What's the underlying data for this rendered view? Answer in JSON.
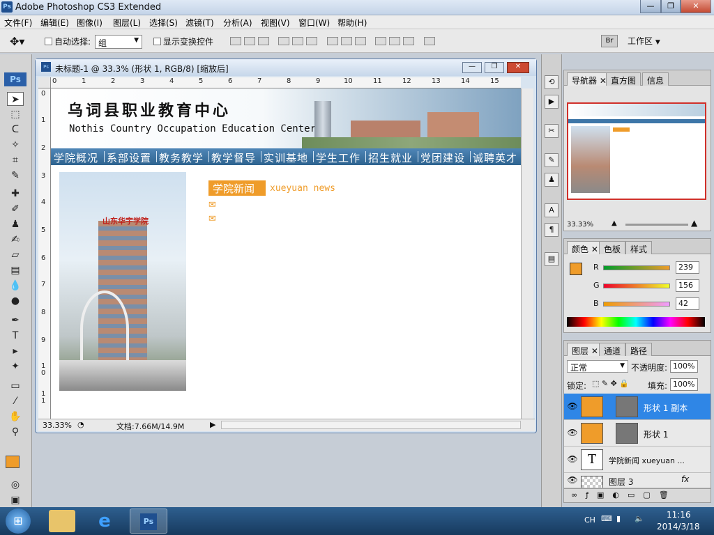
{
  "titlebar": {
    "icon_text": "Ps",
    "title": "Adobe Photoshop CS3 Extended"
  },
  "window_controls": {
    "minimize": "—",
    "restore": "❐",
    "close": "✕"
  },
  "menubar": {
    "items": [
      "文件(F)",
      "编辑(E)",
      "图像(I)",
      "图层(L)",
      "选择(S)",
      "滤镜(T)",
      "分析(A)",
      "视图(V)",
      "窗口(W)",
      "帮助(H)"
    ]
  },
  "options": {
    "auto_select_label": "自动选择:",
    "auto_select_value": "组",
    "show_transform_label": "显示变换控件",
    "workspace_label": "工作区"
  },
  "document": {
    "title": "未标题-1 @ 33.3% (形状 1, RGB/8) [缩放后]",
    "ruler_top": [
      "0",
      "1",
      "2",
      "3",
      "4",
      "5",
      "6",
      "7",
      "8",
      "9",
      "10",
      "11",
      "12",
      "13",
      "14",
      "15"
    ],
    "ruler_left": [
      "0",
      "1",
      "2",
      "3",
      "4",
      "5",
      "6",
      "7",
      "8",
      "9",
      "1\n0",
      "1\n1"
    ],
    "zoom": "33.33%",
    "doc_info": "文档:7.66M/14.9M"
  },
  "webpage": {
    "site_title": "乌词县职业教育中心",
    "site_subtitle": "Nothis Country Occupation Education Center",
    "nav": [
      "学院概况",
      "系部设置",
      "教务教学",
      "教学督导",
      "实训基地",
      "学生工作",
      "招生就业",
      "党团建设",
      "诚聘英才"
    ],
    "photo_sign": "山东华宇学院",
    "news_label": "学院新闻",
    "news_english": "xueyuan news"
  },
  "navigator_panel": {
    "tabs": [
      "导航器",
      "直方图",
      "信息"
    ],
    "zoom": "33.33%"
  },
  "color_panel": {
    "tabs": [
      "颜色",
      "色板",
      "样式"
    ],
    "r_label": "R",
    "g_label": "G",
    "b_label": "B",
    "r": "239",
    "g": "156",
    "b": "42",
    "foreground": "#ef9c2a"
  },
  "layers_panel": {
    "tabs": [
      "图层",
      "通道",
      "路径"
    ],
    "blend_mode": "正常",
    "opacity_label": "不透明度:",
    "opacity": "100%",
    "lock_label": "锁定:",
    "fill_label": "填充:",
    "fill": "100%",
    "layers": [
      {
        "name": "形状 1 副本",
        "selected": true
      },
      {
        "name": "形状 1",
        "selected": false
      },
      {
        "name": "学院新闻   xueyuan ...",
        "selected": false
      },
      {
        "name": "图层 3",
        "selected": false
      }
    ]
  },
  "taskbar": {
    "language": "CH",
    "time": "11:16",
    "date": "2014/3/18"
  }
}
